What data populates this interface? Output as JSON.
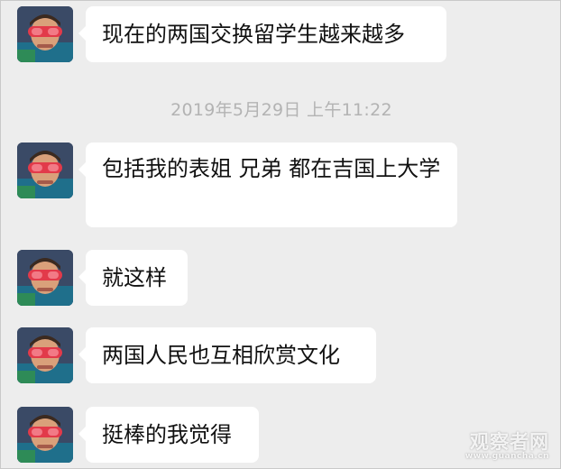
{
  "chat": {
    "messages": [
      {
        "text": "现在的两国交换留学生越来越多"
      },
      {
        "text": "包括我的表姐 兄弟 都在吉国上大学"
      },
      {
        "text": "就这样"
      },
      {
        "text": "两国人民也互相欣赏文化"
      },
      {
        "text": "挺棒的我觉得"
      }
    ],
    "timestamp": "2019年5月29日 上午11:22"
  },
  "watermark": {
    "main": "观察者网",
    "url": "www.guancha.cn"
  },
  "colors": {
    "background": "#ededed",
    "bubble": "#ffffff",
    "timestamp_text": "#b3b3b3",
    "message_text": "#111111"
  },
  "icons": {
    "avatar": "avatar-child-red-goggles"
  }
}
